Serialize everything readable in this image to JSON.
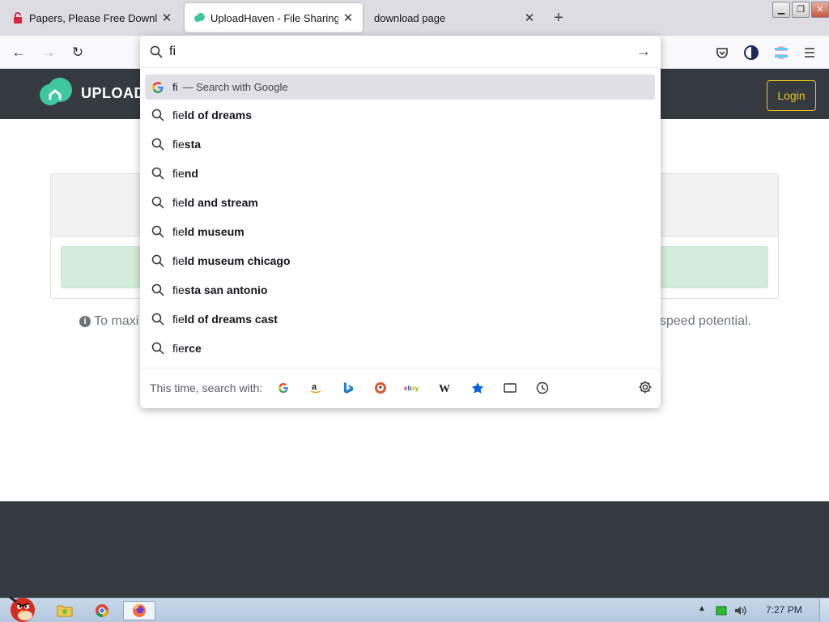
{
  "browser": {
    "tabs": [
      {
        "title": "Papers, Please Free Download (",
        "active": false
      },
      {
        "title": "UploadHaven - File Sharing Ma",
        "active": true
      },
      {
        "title": "download page",
        "active": false
      }
    ],
    "new_tab_label": "+",
    "window_buttons": {
      "minimize": "▁",
      "restore": "❐",
      "close": "✕"
    }
  },
  "nav": {
    "back_label": "←",
    "forward_label": "→",
    "reload_label": "↻"
  },
  "url_dropdown": {
    "input_value": "fi",
    "go_label": "→",
    "top_suggestion": {
      "text": "fi",
      "sub": "— Search with Google"
    },
    "suggestions": [
      {
        "prefix": "fie",
        "bold": "ld of dreams"
      },
      {
        "prefix": "fie",
        "bold": "sta"
      },
      {
        "prefix": "fie",
        "bold": "nd"
      },
      {
        "prefix": "fie",
        "bold": "ld and stream"
      },
      {
        "prefix": "fie",
        "bold": "ld museum"
      },
      {
        "prefix": "fie",
        "bold": "ld museum chicago"
      },
      {
        "prefix": "fie",
        "bold": "sta san antonio"
      },
      {
        "prefix": "fie",
        "bold": "ld of dreams cast"
      },
      {
        "prefix": "fie",
        "bold": "rce"
      }
    ],
    "engines_label": "This time, search with:",
    "engines": [
      "google-icon",
      "amazon-icon",
      "bing-icon",
      "duckduckgo-icon",
      "ebay-icon",
      "wikipedia-icon",
      "bookmarks-icon",
      "tabs-icon",
      "history-icon"
    ]
  },
  "site": {
    "logo_text": "UPLOAD",
    "login_label": "Login",
    "tip_text": "To maxi",
    "tip_right_text": "speed potential."
  },
  "taskbar": {
    "clock": "7:27 PM"
  },
  "colors": {
    "site_header": "#343a40",
    "login_accent": "#f0c419",
    "alert_bg": "#d4edda",
    "tab_strip": "#dcdce2"
  }
}
